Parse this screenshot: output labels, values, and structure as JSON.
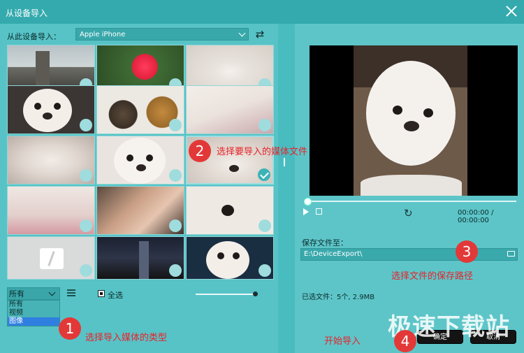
{
  "window": {
    "title": "从设备导入"
  },
  "source": {
    "label": "从此设备导入：",
    "device": "Apple iPhone"
  },
  "thumbnails": [
    {
      "kind": "city",
      "selected": false
    },
    {
      "kind": "flower",
      "selected": false
    },
    {
      "kind": "dog-sleeping",
      "selected": false
    },
    {
      "kind": "dog-face",
      "selected": false
    },
    {
      "kind": "food",
      "selected": false
    },
    {
      "kind": "dog-sofa",
      "selected": false
    },
    {
      "kind": "dog-blur",
      "selected": false
    },
    {
      "kind": "dog-face",
      "selected": false
    },
    {
      "kind": "dog-closeup",
      "selected": true
    },
    {
      "kind": "dog-pink",
      "selected": false
    },
    {
      "kind": "hand-dog",
      "selected": false
    },
    {
      "kind": "dog-eye",
      "selected": false
    },
    {
      "kind": "broken-file",
      "selected": false
    },
    {
      "kind": "night-city",
      "selected": false
    },
    {
      "kind": "dog-dark",
      "selected": false
    }
  ],
  "filter": {
    "current": "所有",
    "options": [
      "所有",
      "视频",
      "图像"
    ],
    "active_index": 2
  },
  "select_all": {
    "label": "全选"
  },
  "preview": {
    "time": "00:00:00 / 00:00:00"
  },
  "save": {
    "label": "保存文件至：",
    "path": "E:\\DeviceExport\\"
  },
  "selected_info": "已选文件：5个, 2.9MB",
  "buttons": {
    "ok": "确定",
    "cancel": "取消"
  },
  "annotations": [
    {
      "num": "1",
      "text": "选择导入媒体的类型"
    },
    {
      "num": "2",
      "text": "选择要导入的媒体文件"
    },
    {
      "num": "3",
      "text": "选择文件的保存路径"
    },
    {
      "num": "4",
      "text": "开始导入"
    }
  ],
  "watermark": "极速下载站",
  "colors": {
    "accent": "#3fb6b9",
    "annotation": "#e33838"
  }
}
